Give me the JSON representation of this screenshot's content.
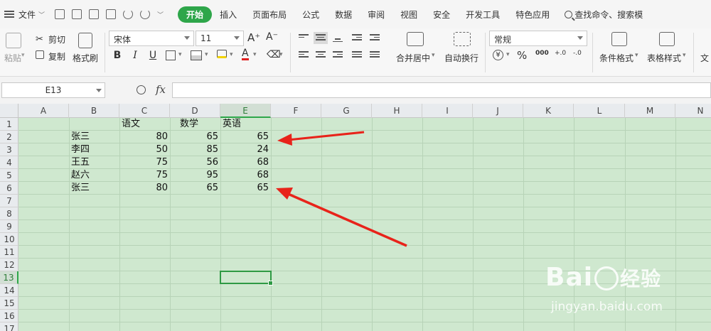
{
  "menubar": {
    "file_label": "文件",
    "tabs": [
      "开始",
      "插入",
      "页面布局",
      "公式",
      "数据",
      "审阅",
      "视图",
      "安全",
      "开发工具",
      "特色应用"
    ],
    "search_label": "查找命令、搜索模"
  },
  "ribbon": {
    "paste_label": "粘贴",
    "cut_label": "剪切",
    "copy_label": "复制",
    "format_painter_label": "格式刷",
    "font_name": "宋体",
    "font_size": "11",
    "bold": "B",
    "italic": "I",
    "underline": "U",
    "merge_label": "合并居中",
    "wrap_label": "自动换行",
    "number_format": "常规",
    "percent": "%",
    "thousands": "000",
    "dec_inc": "+.0",
    "dec_dec": "-.0",
    "cond_format_label": "条件格式",
    "table_style_label": "表格样式",
    "overflow_label": "文"
  },
  "formula_bar": {
    "name_box": "E13",
    "fx_label": "fx",
    "formula": ""
  },
  "sheet": {
    "columns": [
      "A",
      "B",
      "C",
      "D",
      "E",
      "F",
      "G",
      "H",
      "I",
      "J",
      "K",
      "L",
      "M",
      "N"
    ],
    "rows": [
      "1",
      "2",
      "3",
      "4",
      "5",
      "6",
      "7",
      "8",
      "9",
      "10",
      "11",
      "12",
      "13",
      "14",
      "15",
      "16",
      "17"
    ],
    "active_cell": "E13",
    "headers": {
      "c": "语文",
      "d": "数学",
      "e": "英语"
    },
    "data": [
      {
        "name": "张三",
        "c": "80",
        "d": "65",
        "e": "65"
      },
      {
        "name": "李四",
        "c": "50",
        "d": "85",
        "e": "24"
      },
      {
        "name": "王五",
        "c": "75",
        "d": "56",
        "e": "68"
      },
      {
        "name": "赵六",
        "c": "75",
        "d": "95",
        "e": "68"
      },
      {
        "name": "张三",
        "c": "80",
        "d": "65",
        "e": "65"
      }
    ]
  },
  "annotations": {
    "arrow_color": "#e8231a"
  },
  "watermark": {
    "brand": "Bai",
    "brand_suffix": "经验",
    "url": "jingyan.baidu.com"
  },
  "colors": {
    "accent": "#2ea64a",
    "grid_bg": "#cfe8cf"
  }
}
